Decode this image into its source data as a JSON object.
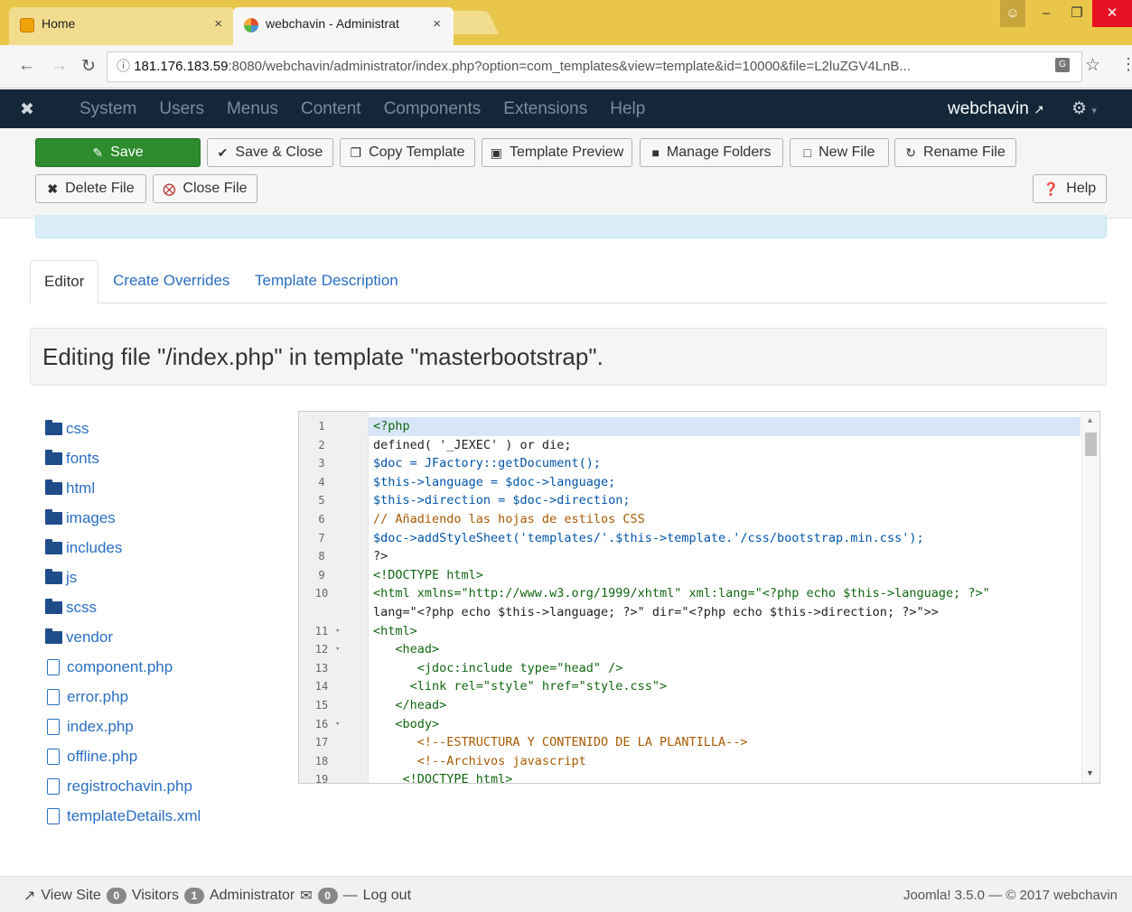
{
  "browser": {
    "tabs": [
      {
        "label": "Home",
        "close": "×"
      },
      {
        "label": "webchavin - Administrat",
        "close": "×"
      }
    ],
    "url_host": "181.176.183.59",
    "url_rest": ":8080/webchavin/administrator/index.php?option=com_templates&view=template&id=10000&file=L2luZGV4LnB..."
  },
  "nav": {
    "items": [
      "System",
      "Users",
      "Menus",
      "Content",
      "Components",
      "Extensions",
      "Help"
    ],
    "user": "webchavin"
  },
  "toolbar": {
    "save": "Save",
    "save_close": "Save & Close",
    "copy_template": "Copy Template",
    "template_preview": "Template Preview",
    "manage_folders": "Manage Folders",
    "new_file": "New File",
    "rename_file": "Rename File",
    "delete_file": "Delete File",
    "close_file": "Close File",
    "help": "Help"
  },
  "tabs": [
    "Editor",
    "Create Overrides",
    "Template Description"
  ],
  "heading": "Editing file \"/index.php\" in template \"masterbootstrap\".",
  "tree": {
    "folders": [
      "css",
      "fonts",
      "html",
      "images",
      "includes",
      "js",
      "scss",
      "vendor"
    ],
    "files": [
      "component.php",
      "error.php",
      "index.php",
      "offline.php",
      "registrochavin.php",
      "templateDetails.xml"
    ]
  },
  "editor": {
    "lines": [
      {
        "n": "1",
        "t": "<?php"
      },
      {
        "n": "2",
        "t": "defined( '_JEXEC' ) or die;"
      },
      {
        "n": "3",
        "t": "$doc = JFactory::getDocument();"
      },
      {
        "n": "4",
        "t": "$this->language = $doc->language;"
      },
      {
        "n": "5",
        "t": "$this->direction = $doc->direction;"
      },
      {
        "n": "6",
        "t": "// Añadiendo las hojas de estilos CSS"
      },
      {
        "n": "7",
        "t": "$doc->addStyleSheet('templates/'.$this->template.'/css/bootstrap.min.css');"
      },
      {
        "n": "8",
        "t": "?>"
      },
      {
        "n": "9",
        "t": "<!DOCTYPE html>"
      },
      {
        "n": "10",
        "t": "<html xmlns=\"http://www.w3.org/1999/xhtml\" xml:lang=\"<?php echo $this->language; ?>\""
      },
      {
        "n": "",
        "t": "lang=\"<?php echo $this->language; ?>\" dir=\"<?php echo $this->direction; ?>\">>"
      },
      {
        "n": "11",
        "t": "<html>"
      },
      {
        "n": "12",
        "t": "   <head>"
      },
      {
        "n": "13",
        "t": "      <jdoc:include type=\"head\" />"
      },
      {
        "n": "14",
        "t": "     <link rel=\"style\" href=\"style.css\">"
      },
      {
        "n": "15",
        "t": "   </head>"
      },
      {
        "n": "16",
        "t": "   <body>"
      },
      {
        "n": "17",
        "t": "      <!--ESTRUCTURA Y CONTENIDO DE LA PLANTILLA-->"
      },
      {
        "n": "18",
        "t": "      <!--Archivos javascript"
      },
      {
        "n": "19",
        "t": "    <!DOCTYPE html>"
      }
    ],
    "fold_marker": "▾"
  },
  "status": {
    "view_site": "View Site",
    "visitors_count": "0",
    "visitors": "Visitors",
    "admin_count": "1",
    "administrator": "Administrator",
    "messages_count": "0",
    "logout": "Log out",
    "version": "Joomla! 3.5.0 — © 2017 webchavin"
  }
}
